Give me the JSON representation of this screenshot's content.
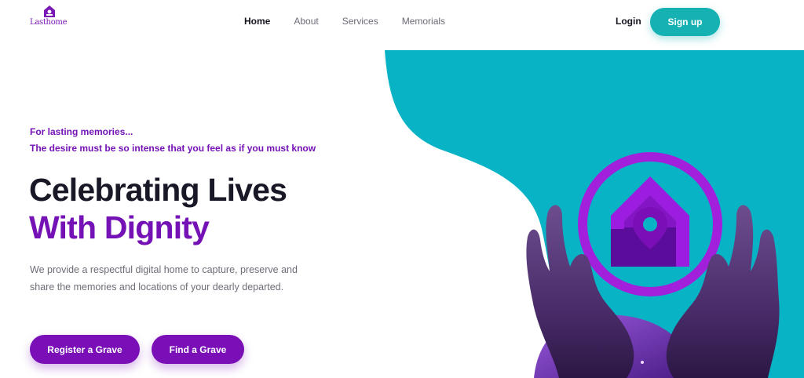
{
  "brand": {
    "logo_text": "Lasthome"
  },
  "nav": {
    "items": [
      {
        "label": "Home"
      },
      {
        "label": "About"
      },
      {
        "label": "Services"
      },
      {
        "label": "Memorials"
      }
    ],
    "active": "Home"
  },
  "auth": {
    "login_label": "Login",
    "signup_label": "Sign up"
  },
  "hero": {
    "tagline_line1": "For lasting memories...",
    "tagline_line2": "The desire must be so intense that you feel as if you must know",
    "title_line1": "Celebrating Lives",
    "title_line2": "With Dignity",
    "description": "We provide a respectful digital home to capture, preserve and share the memories and locations of your dearly departed.",
    "primary_button": "Register a Grave",
    "secondary_button": "Find a Grave"
  },
  "colors": {
    "brand_purple": "#7412b5",
    "accent_teal": "#16b1b3",
    "title_dark": "#181826",
    "text_muted": "#6d6d78"
  },
  "icons": {
    "logo": "house-pin-icon",
    "hero_emblem": "house-location-pin-icon",
    "illustration": "cupped-hands-illustration"
  }
}
